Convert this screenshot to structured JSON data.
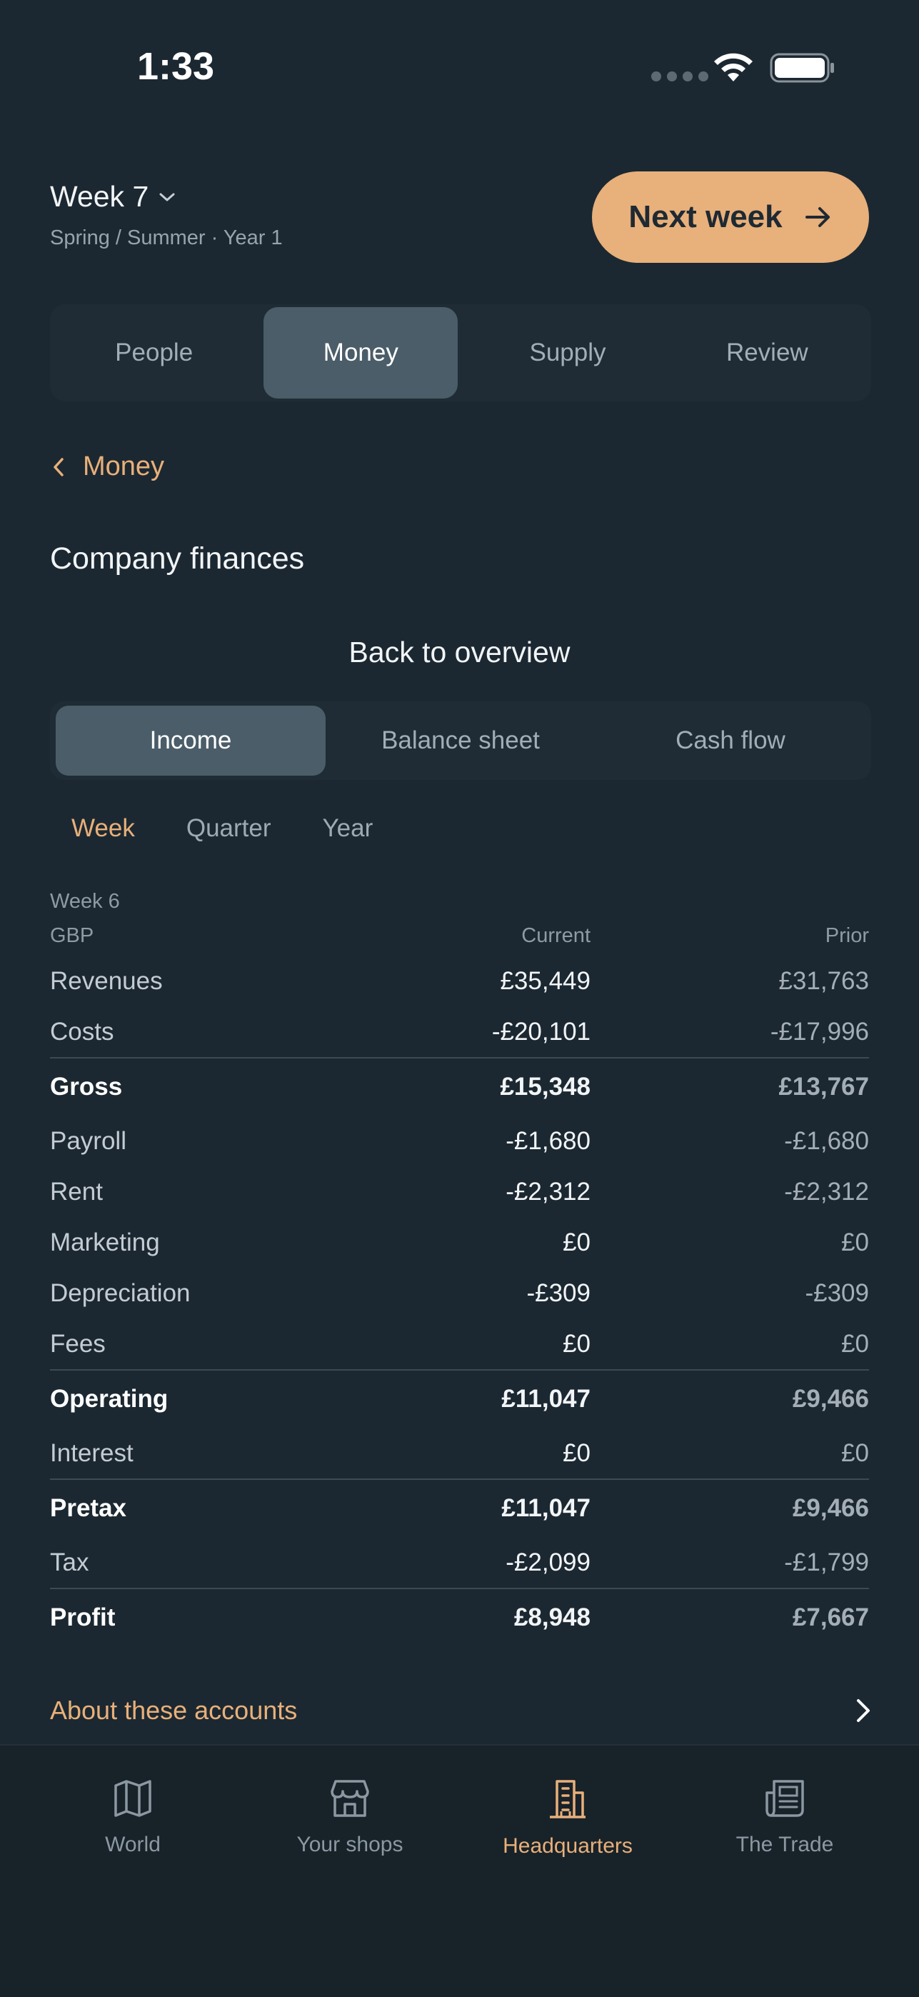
{
  "status": {
    "time": "1:33"
  },
  "header": {
    "week_title": "Week 7",
    "season": "Spring / Summer · Year 1",
    "next_week_label": "Next week"
  },
  "main_tabs": [
    {
      "label": "People",
      "active": false
    },
    {
      "label": "Money",
      "active": true
    },
    {
      "label": "Supply",
      "active": false
    },
    {
      "label": "Review",
      "active": false
    }
  ],
  "back_link": "Money",
  "section_title": "Company finances",
  "overview_label": "Back to overview",
  "finance_tabs": [
    {
      "label": "Income",
      "active": true
    },
    {
      "label": "Balance sheet",
      "active": false
    },
    {
      "label": "Cash flow",
      "active": false
    }
  ],
  "period_tabs": [
    {
      "label": "Week",
      "active": true
    },
    {
      "label": "Quarter",
      "active": false
    },
    {
      "label": "Year",
      "active": false
    }
  ],
  "statement": {
    "week_label": "Week 6",
    "currency": "GBP",
    "current_header": "Current",
    "prior_header": "Prior",
    "rows": [
      {
        "label": "Revenues",
        "current": "£35,449",
        "prior": "£31,763"
      },
      {
        "label": "Costs",
        "current": "-£20,101",
        "prior": "-£17,996"
      },
      {
        "label": "Gross",
        "current": "£15,348",
        "prior": "£13,767"
      },
      {
        "label": "Payroll",
        "current": "-£1,680",
        "prior": "-£1,680"
      },
      {
        "label": "Rent",
        "current": "-£2,312",
        "prior": "-£2,312"
      },
      {
        "label": "Marketing",
        "current": "£0",
        "prior": "£0"
      },
      {
        "label": "Depreciation",
        "current": "-£309",
        "prior": "-£309"
      },
      {
        "label": "Fees",
        "current": "£0",
        "prior": "£0"
      },
      {
        "label": "Operating",
        "current": "£11,047",
        "prior": "£9,466"
      },
      {
        "label": "Interest",
        "current": "£0",
        "prior": "£0"
      },
      {
        "label": "Pretax",
        "current": "£11,047",
        "prior": "£9,466"
      },
      {
        "label": "Tax",
        "current": "-£2,099",
        "prior": "-£1,799"
      },
      {
        "label": "Profit",
        "current": "£8,948",
        "prior": "£7,667"
      }
    ]
  },
  "about_link": "About these accounts",
  "bottom_nav": [
    {
      "label": "World",
      "icon": "map-icon",
      "active": false
    },
    {
      "label": "Your shops",
      "icon": "shop-icon",
      "active": false
    },
    {
      "label": "Headquarters",
      "icon": "building-icon",
      "active": true
    },
    {
      "label": "The Trade",
      "icon": "newspaper-icon",
      "active": false
    }
  ],
  "colors": {
    "background": "#1c2831",
    "accent": "#e8b07a",
    "active_tab": "#4a5d69"
  }
}
